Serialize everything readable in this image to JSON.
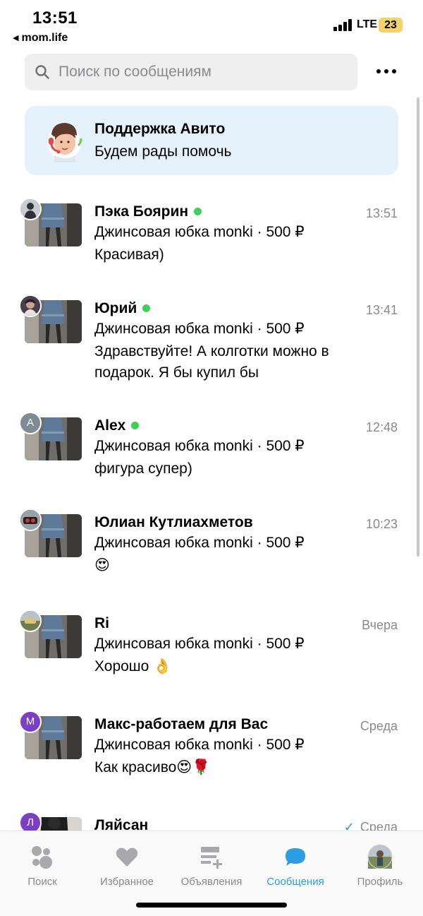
{
  "status_bar": {
    "time": "13:51",
    "back_app": "mom.life",
    "network": "LTE",
    "battery": "23"
  },
  "search": {
    "placeholder": "Поиск по сообщениям"
  },
  "support": {
    "title": "Поддержка Авито",
    "subtitle": "Будем рады помочь"
  },
  "chats": [
    {
      "name": "Пэка Боярин",
      "online": true,
      "time": "13:51",
      "item": "Джинсовая юбка monki · 500 ₽",
      "message": "Красивая)",
      "avatar_letter": ""
    },
    {
      "name": "Юрий",
      "online": true,
      "time": "13:41",
      "item": "Джинсовая юбка monki · 500 ₽",
      "message": "Здравствуйте! А колготки можно в подарок. Я бы купил бы",
      "avatar_letter": ""
    },
    {
      "name": "Alex",
      "online": true,
      "time": "12:48",
      "item": "Джинсовая юбка monki · 500 ₽",
      "message": "фигура супер)",
      "avatar_letter": "A"
    },
    {
      "name": "Юлиан Кутлиахметов",
      "online": false,
      "time": "10:23",
      "item": "Джинсовая юбка monki · 500 ₽",
      "message": "😍",
      "avatar_letter": ""
    },
    {
      "name": "Ri",
      "online": false,
      "time": "Вчера",
      "item": "Джинсовая юбка monki · 500 ₽",
      "message": "Хорошо  👌",
      "avatar_letter": ""
    },
    {
      "name": "Макс-работаем для Вас",
      "online": false,
      "time": "Среда",
      "item": "Джинсовая юбка monki · 500 ₽",
      "message": "Как красиво😍🌹",
      "avatar_letter": "М"
    },
    {
      "name": "Ляйсан",
      "online": false,
      "time": "Среда",
      "item": "",
      "message": "",
      "avatar_letter": "Л",
      "read_check": "✓"
    }
  ],
  "tab_bar": {
    "search": "Поиск",
    "favorites": "Избранное",
    "ads": "Объявления",
    "messages": "Сообщения",
    "profile": "Профиль"
  },
  "colors": {
    "accent": "#2b9ee3",
    "online": "#3fcf5b",
    "support_bg": "#e5f1fb",
    "battery": "#f5d36a"
  }
}
